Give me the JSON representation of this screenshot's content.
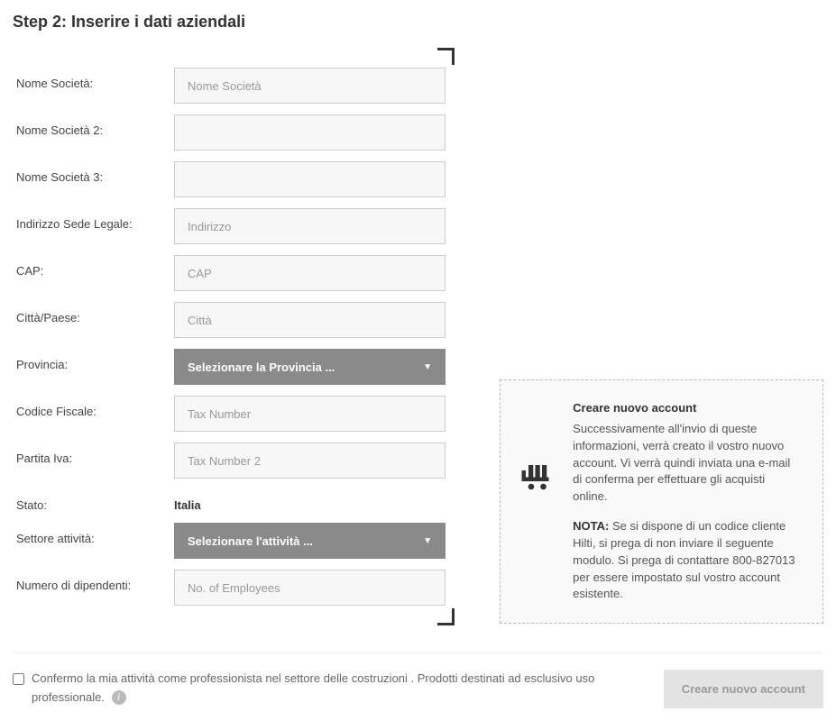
{
  "step_title": "Step 2: Inserire i dati aziendali",
  "fields": {
    "company1": {
      "label": "Nome Società:",
      "placeholder": "Nome Società"
    },
    "company2": {
      "label": "Nome Società 2:",
      "placeholder": ""
    },
    "company3": {
      "label": "Nome Società 3:",
      "placeholder": ""
    },
    "address": {
      "label": "Indirizzo Sede Legale:",
      "placeholder": "Indirizzo"
    },
    "zip": {
      "label": "CAP:",
      "placeholder": "CAP"
    },
    "city": {
      "label": "Città/Paese:",
      "placeholder": "Città"
    },
    "province": {
      "label": "Provincia:",
      "selected": "Selezionare la Provincia ..."
    },
    "taxcode": {
      "label": "Codice Fiscale:",
      "placeholder": "Tax Number"
    },
    "vat": {
      "label": "Partita Iva:",
      "placeholder": "Tax Number 2"
    },
    "state": {
      "label": "Stato:",
      "value": "Italia"
    },
    "sector": {
      "label": "Settore attività:",
      "selected": "Selezionare l'attività ..."
    },
    "employees": {
      "label": "Numero di dipendenti:",
      "placeholder": "No. of Employees"
    }
  },
  "info": {
    "title": "Creare nuovo account",
    "body": "Successivamente all'invio di queste informazioni, verrà creato il vostro nuovo account. Vi verrà quindi inviata una e-mail di conferma per effettuare gli acquisti online.",
    "nota_label": "NOTA:",
    "nota_body": "Se si dispone di un codice cliente Hilti, si prega di non inviare il seguente modulo. Si prega di contattare 800-827013 per essere impostato sul vostro account esistente."
  },
  "confirm_text": "Confermo la mia attività come professionista nel settore delle costruzioni . Prodotti destinati ad esclusivo uso professionale.",
  "submit_label": "Creare nuovo account"
}
